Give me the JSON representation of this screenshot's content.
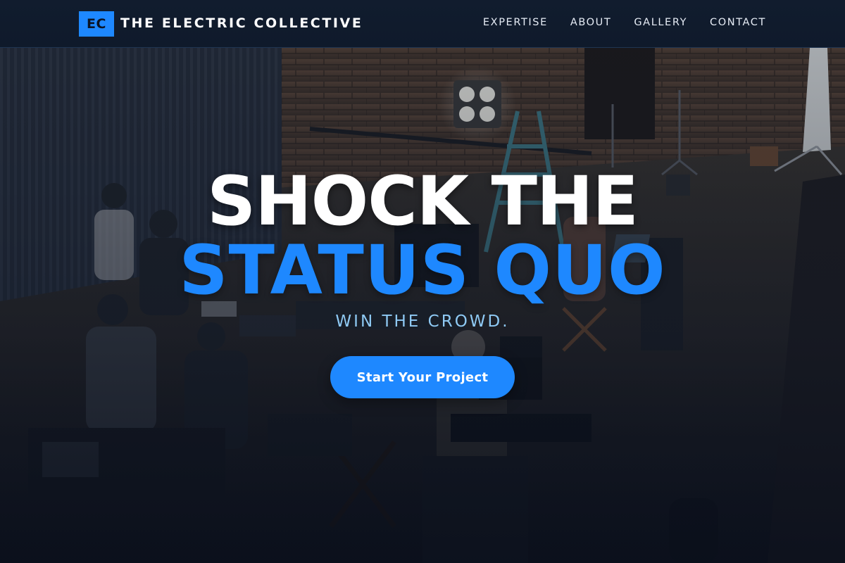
{
  "header": {
    "logo_mark": "EC",
    "brand_name": "THE ELECTRIC COLLECTIVE",
    "nav": [
      {
        "label": "EXPERTISE"
      },
      {
        "label": "ABOUT"
      },
      {
        "label": "GALLERY"
      },
      {
        "label": "CONTACT"
      }
    ]
  },
  "hero": {
    "headline_line1": "SHOCK THE",
    "headline_line2": "STATUS QUO",
    "subheadline": "WIN THE CROWD.",
    "cta_label": "Start Your Project",
    "background_image": "film-set-warehouse-photo"
  },
  "colors": {
    "accent": "#1e88ff",
    "header_bg": "#111c2e",
    "subheadline": "#8fcaf5",
    "headline": "#ffffff"
  }
}
